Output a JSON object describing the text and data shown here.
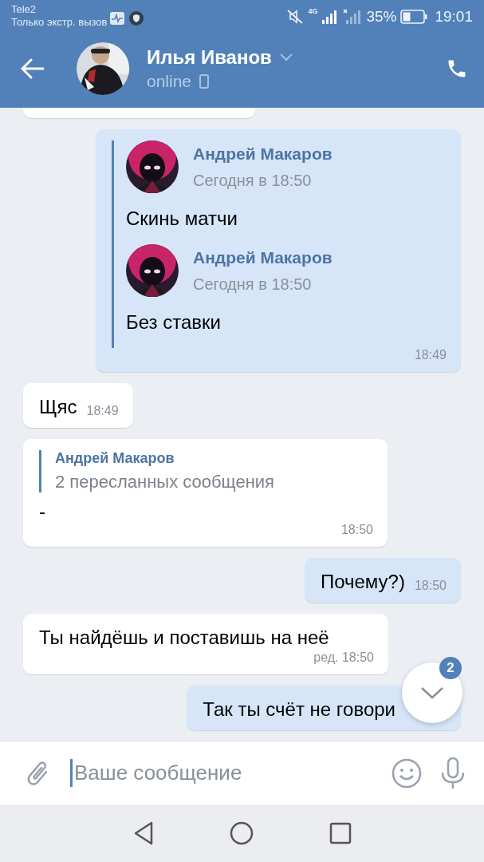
{
  "status_bar": {
    "carrier": "Tele2",
    "carrier_note": "Только экстр. вызов",
    "network": "4G",
    "battery": "35%",
    "time": "19:01"
  },
  "header": {
    "name": "Илья Иванов",
    "status": "online"
  },
  "messages": [
    {
      "kind": "cut",
      "outgoing": false
    },
    {
      "kind": "forwarded_list",
      "outgoing": true,
      "time": "18:49",
      "forwards": [
        {
          "author": "Андрей Макаров",
          "time": "Сегодня в 18:50",
          "text": "Скинь матчи"
        },
        {
          "author": "Андрей Макаров",
          "time": "Сегодня в 18:50",
          "text": "Без ставки"
        }
      ]
    },
    {
      "kind": "text",
      "outgoing": false,
      "text": "Щяс",
      "time": "18:49"
    },
    {
      "kind": "forward_summary",
      "outgoing": false,
      "author": "Андрей Макаров",
      "summary": "2 пересланных сообщения",
      "text": "-",
      "time": "18:50"
    },
    {
      "kind": "text",
      "outgoing": true,
      "text": "Почему?)",
      "time": "18:50"
    },
    {
      "kind": "text",
      "outgoing": false,
      "text": "Ты найдёшь и поставишь на неё",
      "time": "ред. 18:50"
    },
    {
      "kind": "text",
      "outgoing": true,
      "text": "Так ты счёт не говори"
    }
  ],
  "scroll_button": {
    "badge": "2"
  },
  "composer": {
    "placeholder": "Ваше сообщение"
  }
}
